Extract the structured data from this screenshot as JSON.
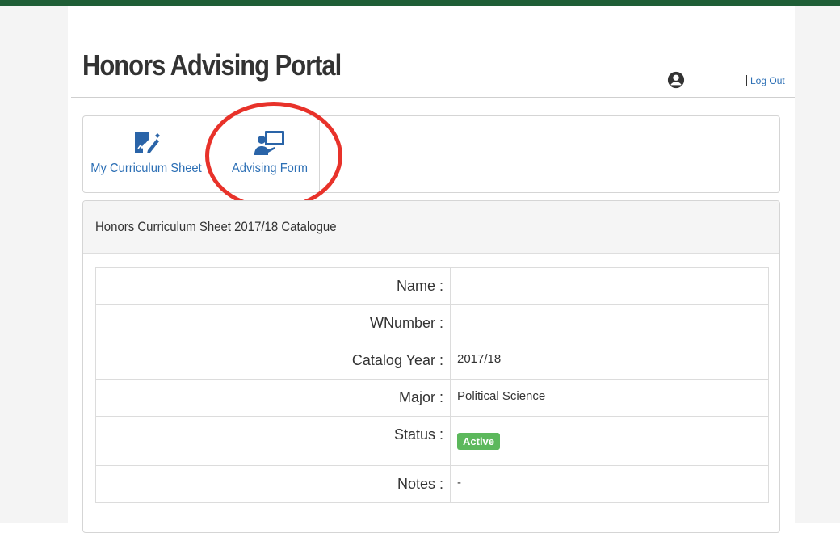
{
  "header": {
    "title": "Honors Advising Portal",
    "logout_label": "Log Out",
    "user_icon": "user-circle-icon"
  },
  "tabs": [
    {
      "label": "My Curriculum Sheet",
      "icon": "edit-document-icon"
    },
    {
      "label": "Advising Form",
      "icon": "presenter-board-icon"
    }
  ],
  "panel": {
    "title": "Honors Curriculum Sheet 2017/18 Catalogue",
    "rows": [
      {
        "label": "Name :",
        "value": ""
      },
      {
        "label": "WNumber :",
        "value": ""
      },
      {
        "label": "Catalog Year :",
        "value": "2017/18"
      },
      {
        "label": "Major :",
        "value": "Political Science"
      },
      {
        "label": "Status :",
        "value": "Active"
      },
      {
        "label": "Notes :",
        "value": "-"
      }
    ]
  },
  "colors": {
    "brand": "#1f5e36",
    "link": "#2c6fb5",
    "badge": "#5cb85c",
    "annotation": "#e8322a"
  }
}
